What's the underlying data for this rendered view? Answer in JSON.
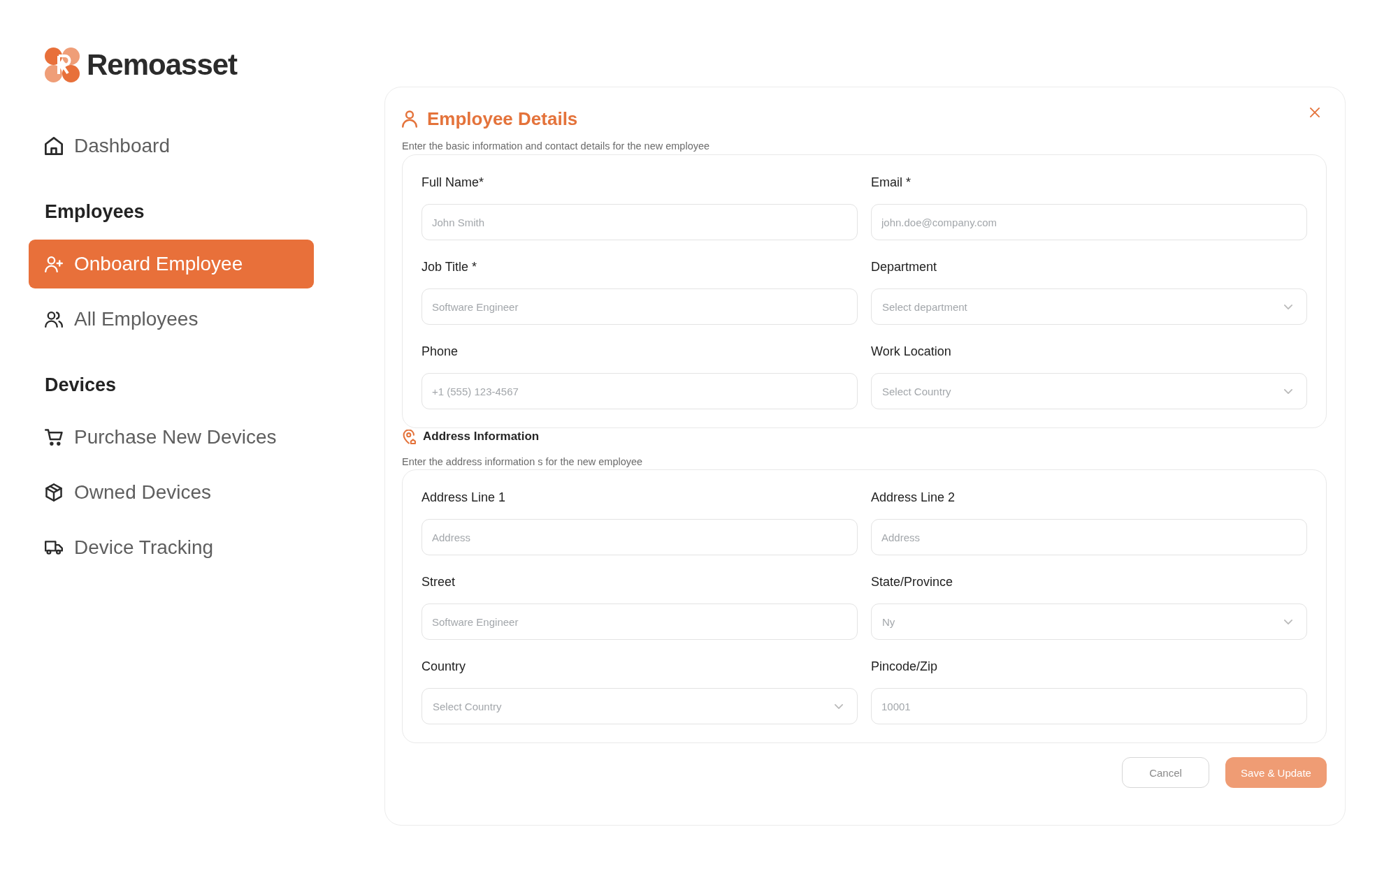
{
  "brand": {
    "name": "Remoasset"
  },
  "sidebar": {
    "sections": [
      {
        "items": [
          {
            "label": "Dashboard",
            "selected": false
          }
        ]
      },
      {
        "heading": "Employees",
        "items": [
          {
            "label": "Onboard Employee",
            "selected": true
          },
          {
            "label": "All Employees",
            "selected": false
          }
        ]
      },
      {
        "heading": "Devices",
        "items": [
          {
            "label": "Purchase New Devices",
            "selected": false
          },
          {
            "label": "Owned Devices",
            "selected": false
          },
          {
            "label": "Device Tracking",
            "selected": false
          }
        ]
      }
    ]
  },
  "panel": {
    "sections": [
      {
        "kind": "main",
        "title": "Employee Details",
        "subtitle": "Enter the basic information and contact details for the new employee",
        "fields": [
          {
            "label": "Full Name*",
            "kind": "text",
            "placeholder": "John Smith"
          },
          {
            "label": "Email *",
            "kind": "text",
            "placeholder": "john.doe@company.com"
          },
          {
            "label": "Job Title *",
            "kind": "text",
            "placeholder": "Software Engineer"
          },
          {
            "label": "Department",
            "kind": "select",
            "placeholder": "Select department"
          },
          {
            "label": "Phone",
            "kind": "text",
            "placeholder": "+1 (555) 123-4567"
          },
          {
            "label": "Work Location",
            "kind": "select",
            "placeholder": "Select Country"
          }
        ]
      },
      {
        "kind": "sub",
        "title": "Address Information",
        "subtitle": "Enter the address information s for the new employee",
        "fields": [
          {
            "label": "Address Line 1",
            "kind": "text",
            "placeholder": "Address"
          },
          {
            "label": "Address Line 2",
            "kind": "text",
            "placeholder": "Address"
          },
          {
            "label": "Street",
            "kind": "text",
            "placeholder": "Software Engineer"
          },
          {
            "label": "State/Province",
            "kind": "select",
            "placeholder": "Ny"
          },
          {
            "label": "Country",
            "kind": "select",
            "placeholder": "Select Country"
          },
          {
            "label": "Pincode/Zip",
            "kind": "text",
            "placeholder": "10001"
          }
        ]
      }
    ],
    "buttons": [
      {
        "label": "Cancel",
        "kind": "secondary"
      },
      {
        "label": "Save & Update",
        "kind": "primary"
      }
    ]
  }
}
